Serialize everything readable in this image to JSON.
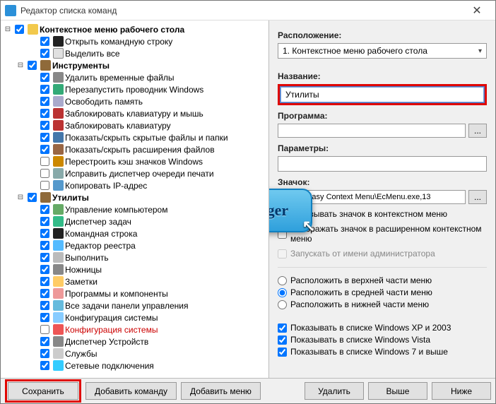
{
  "window": {
    "title": "Редактор списка команд"
  },
  "tree": {
    "root": {
      "label": "Контекстное меню рабочего стола",
      "checked": true,
      "items": [
        {
          "label": "Открыть командную строку",
          "checked": true,
          "icon": "ic-cmd"
        },
        {
          "label": "Выделить все",
          "checked": true,
          "icon": "ic-sel"
        }
      ],
      "groups": [
        {
          "label": "Инструменты",
          "checked": true,
          "items": [
            {
              "label": "Удалить временные файлы",
              "checked": true,
              "icon": "ic-trash"
            },
            {
              "label": "Перезапустить проводник Windows",
              "checked": true,
              "icon": "ic-reload"
            },
            {
              "label": "Освободить память",
              "checked": true,
              "icon": "ic-mem"
            },
            {
              "label": "Заблокировать клавиатуру и мышь",
              "checked": true,
              "icon": "ic-lock"
            },
            {
              "label": "Заблокировать клавиатуру",
              "checked": true,
              "icon": "ic-lock"
            },
            {
              "label": "Показать/скрыть скрытые файлы и папки",
              "checked": true,
              "icon": "ic-eye"
            },
            {
              "label": "Показать/скрыть расширения файлов",
              "checked": true,
              "icon": "ic-ext"
            },
            {
              "label": "Перестроить кэш значков Windows",
              "checked": false,
              "icon": "ic-rebuild"
            },
            {
              "label": "Исправить диспетчер очереди печати",
              "checked": false,
              "icon": "ic-print"
            },
            {
              "label": "Копировать IP-адрес",
              "checked": false,
              "icon": "ic-ip"
            }
          ]
        },
        {
          "label": "Утилиты",
          "checked": true,
          "items": [
            {
              "label": "Управление компьютером",
              "checked": true,
              "icon": "ic-comp"
            },
            {
              "label": "Диспетчер задач",
              "checked": true,
              "icon": "ic-task"
            },
            {
              "label": "Командная строка",
              "checked": true,
              "icon": "ic-cmd"
            },
            {
              "label": "Редактор реестра",
              "checked": true,
              "icon": "ic-reg"
            },
            {
              "label": "Выполнить",
              "checked": true,
              "icon": "ic-run"
            },
            {
              "label": "Ножницы",
              "checked": true,
              "icon": "ic-scis"
            },
            {
              "label": "Заметки",
              "checked": true,
              "icon": "ic-note"
            },
            {
              "label": "Программы и компоненты",
              "checked": true,
              "icon": "ic-prog"
            },
            {
              "label": "Все задачи панели управления",
              "checked": true,
              "icon": "ic-ctrl"
            },
            {
              "label": "Конфигурация системы",
              "checked": true,
              "icon": "ic-cfg"
            },
            {
              "label": "Конфигурация системы",
              "checked": false,
              "icon": "ic-cfg2",
              "red": true
            },
            {
              "label": "Диспетчер Устройств",
              "checked": true,
              "icon": "ic-dev"
            },
            {
              "label": "Службы",
              "checked": true,
              "icon": "ic-svc"
            },
            {
              "label": "Сетевые подключения",
              "checked": true,
              "icon": "ic-net"
            }
          ]
        }
      ]
    }
  },
  "right": {
    "location_label": "Расположение:",
    "location_value": "1. Контекстное меню рабочего стола",
    "name_label": "Название:",
    "name_value": "Утилиты",
    "program_label": "Программа:",
    "program_value": "",
    "params_label": "Параметры:",
    "params_value": "",
    "icon_label": "Значок:",
    "icon_value": "Files%\\Easy Context Menu\\EcMenu.exe,13",
    "chk_show_context": "Показывать значок в контекстном меню",
    "chk_show_ext": "Отображать значок в расширенном контекстном меню",
    "chk_run_admin": "Запускать от имени администратора",
    "radio_top": "Расположить в верхней части меню",
    "radio_mid": "Расположить в средней части меню",
    "radio_bot": "Расположить в нижней части меню",
    "chk_xp": "Показывать в списке Windows XP и 2003",
    "chk_vista": "Показывать в списке Windows Vista",
    "chk_win7": "Показывать в списке Windows 7 и выше"
  },
  "buttons": {
    "save": "Сохранить",
    "add_cmd": "Добавить команду",
    "add_menu": "Добавить меню",
    "delete": "Удалить",
    "up": "Выше",
    "down": "Ниже"
  },
  "badge": "Mr.Proger"
}
